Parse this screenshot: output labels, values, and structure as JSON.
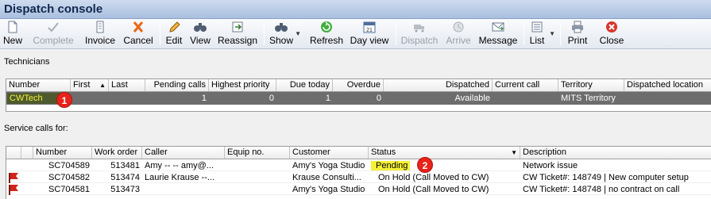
{
  "window": {
    "title": "Dispatch console"
  },
  "toolbar": [
    {
      "label": "New",
      "icon": "new-document-icon",
      "enabled": true
    },
    {
      "label": "Complete",
      "icon": "complete-check-icon",
      "enabled": false
    },
    {
      "label": "Invoice",
      "icon": "invoice-icon",
      "enabled": true
    },
    {
      "label": "Cancel",
      "icon": "cancel-x-icon",
      "enabled": true
    },
    {
      "label": "Edit",
      "icon": "pencil-icon",
      "enabled": true
    },
    {
      "label": "View",
      "icon": "binoculars-icon",
      "enabled": true
    },
    {
      "label": "Reassign",
      "icon": "reassign-icon",
      "enabled": true
    },
    {
      "label": "Show",
      "icon": "show-binoculars-icon",
      "enabled": true
    },
    {
      "label": "Refresh",
      "icon": "refresh-icon",
      "enabled": true
    },
    {
      "label": "Day view",
      "icon": "calendar-icon",
      "enabled": true
    },
    {
      "label": "Dispatch",
      "icon": "dispatch-truck-icon",
      "enabled": false
    },
    {
      "label": "Arrive",
      "icon": "arrive-clock-icon",
      "enabled": false
    },
    {
      "label": "Message",
      "icon": "message-envelope-icon",
      "enabled": true
    },
    {
      "label": "List",
      "icon": "list-icon",
      "enabled": true
    },
    {
      "label": "Print",
      "icon": "printer-icon",
      "enabled": true
    },
    {
      "label": "Close",
      "icon": "close-x-icon",
      "enabled": true
    }
  ],
  "technicians": {
    "section_label": "Technicians",
    "columns": [
      "Number",
      "First",
      "Last",
      "Pending calls",
      "Highest priority",
      "Due today",
      "Overdue",
      "Dispatched",
      "Current call",
      "Territory",
      "Dispatched location"
    ],
    "sort_indicator": "▲",
    "rows": [
      {
        "number": "CWTech",
        "first": "",
        "last": "",
        "pending_calls": "1",
        "highest_priority": "0",
        "due_today": "1",
        "overdue": "0",
        "dispatched": "Available",
        "current_call": "",
        "territory": "MITS Territory",
        "dispatched_location": ""
      }
    ],
    "badge": "1"
  },
  "service_calls": {
    "section_label": "Service calls for:",
    "columns": [
      "Number",
      "Work order",
      "Caller",
      "Equip no.",
      "Customer",
      "Status",
      "Description"
    ],
    "status_filter_indicator": "▼",
    "rows": [
      {
        "flag": false,
        "number": "SC704589",
        "work_order": "513481",
        "caller": "Amy -- -- amy@...",
        "equip_no": "",
        "customer": "Amy's Yoga Studio",
        "status": "Pending",
        "description": "Network issue"
      },
      {
        "flag": true,
        "number": "SC704582",
        "work_order": "513474",
        "caller": "Laurie Krause --...",
        "equip_no": "",
        "customer": "Krause Consulti...",
        "status": "On Hold (Call Moved to CW)",
        "description": "CW Ticket#: 148749 | New computer setup"
      },
      {
        "flag": true,
        "number": "SC704581",
        "work_order": "513473",
        "caller": "",
        "equip_no": "",
        "customer": "Amy's Yoga Studio",
        "status": "On Hold (Call Moved to CW)",
        "description": "CW Ticket#: 148748 | no contract on call"
      }
    ],
    "badge": "2"
  },
  "colors": {
    "selected_row": "#6d6d6d",
    "highlight_yellow": "#f6f137",
    "badge_red": "#e8231a",
    "title_text": "#10284e"
  }
}
